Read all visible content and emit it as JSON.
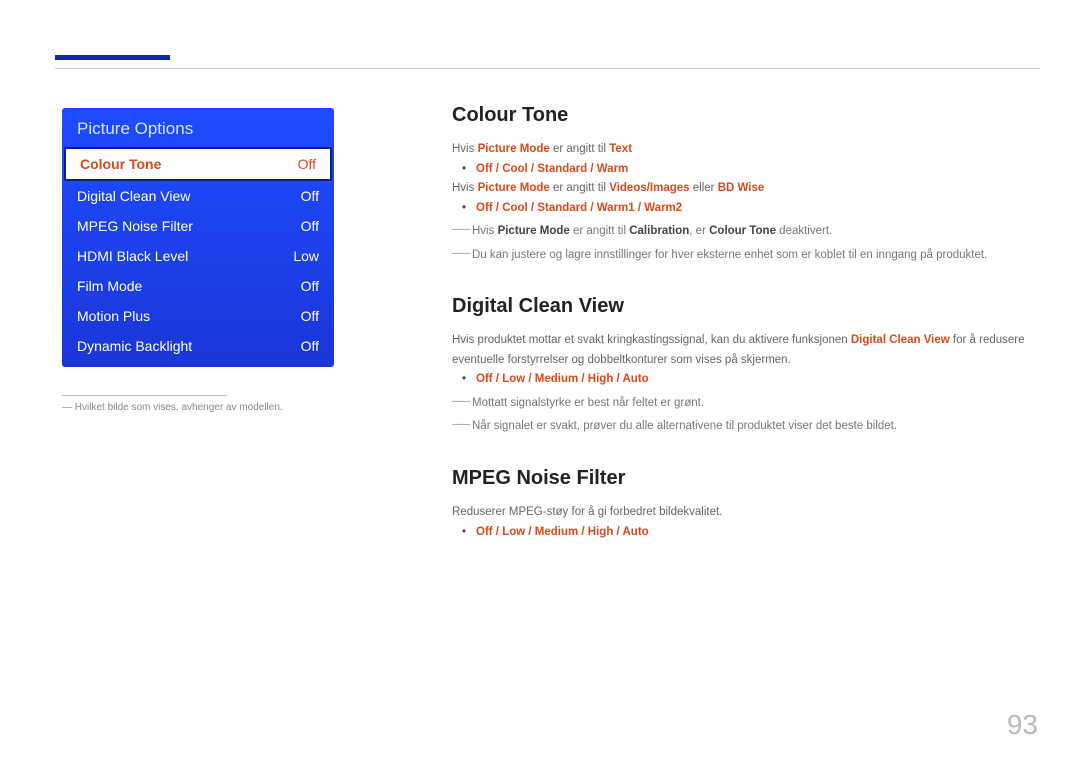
{
  "page_number": "93",
  "osd": {
    "title": "Picture Options",
    "rows": [
      {
        "label": "Colour Tone",
        "value": "Off"
      },
      {
        "label": "Digital Clean View",
        "value": "Off"
      },
      {
        "label": "MPEG Noise Filter",
        "value": "Off"
      },
      {
        "label": "HDMI Black Level",
        "value": "Low"
      },
      {
        "label": "Film Mode",
        "value": "Off"
      },
      {
        "label": "Motion Plus",
        "value": "Off"
      },
      {
        "label": "Dynamic Backlight",
        "value": "Off"
      }
    ],
    "footnote": "Hvilket bilde som vises, avhenger av modellen."
  },
  "section_ct": {
    "heading": "Colour Tone",
    "line1_pre": "Hvis ",
    "line1_b1": "Picture Mode",
    "line1_mid": " er angitt til ",
    "line1_b2": "Text",
    "bullet1": "Off / Cool / Standard / Warm",
    "line2_pre": "Hvis ",
    "line2_b1": "Picture Mode",
    "line2_mid": " er angitt til ",
    "line2_b2": "Videos/Images",
    "line2_mid2": " eller ",
    "line2_b3": "BD Wise",
    "bullet2": "Off / Cool / Standard / Warm1 / Warm2",
    "dash1_pre": "Hvis ",
    "dash1_b1": "Picture Mode",
    "dash1_mid": " er angitt til ",
    "dash1_b2": "Calibration",
    "dash1_mid2": ", er ",
    "dash1_b3": "Colour Tone",
    "dash1_post": " deaktivert.",
    "dash2": "Du kan justere og lagre innstillinger for hver eksterne enhet som er koblet til en inngang på produktet."
  },
  "section_dcv": {
    "heading": "Digital Clean View",
    "para_pre": "Hvis produktet mottar et svakt kringkastingssignal, kan du aktivere funksjonen ",
    "para_b": "Digital Clean View",
    "para_post": " for å redusere eventuelle forstyrrelser og dobbeltkonturer som vises på skjermen.",
    "bullet": "Off / Low / Medium / High / Auto",
    "dash1": "Mottatt signalstyrke er best når feltet er grønt.",
    "dash2": "Når signalet er svakt, prøver du alle alternativene til produktet viser det beste bildet."
  },
  "section_mnf": {
    "heading": "MPEG Noise Filter",
    "para": "Reduserer MPEG-støy for å gi forbedret bildekvalitet.",
    "bullet": "Off / Low / Medium / High / Auto"
  }
}
